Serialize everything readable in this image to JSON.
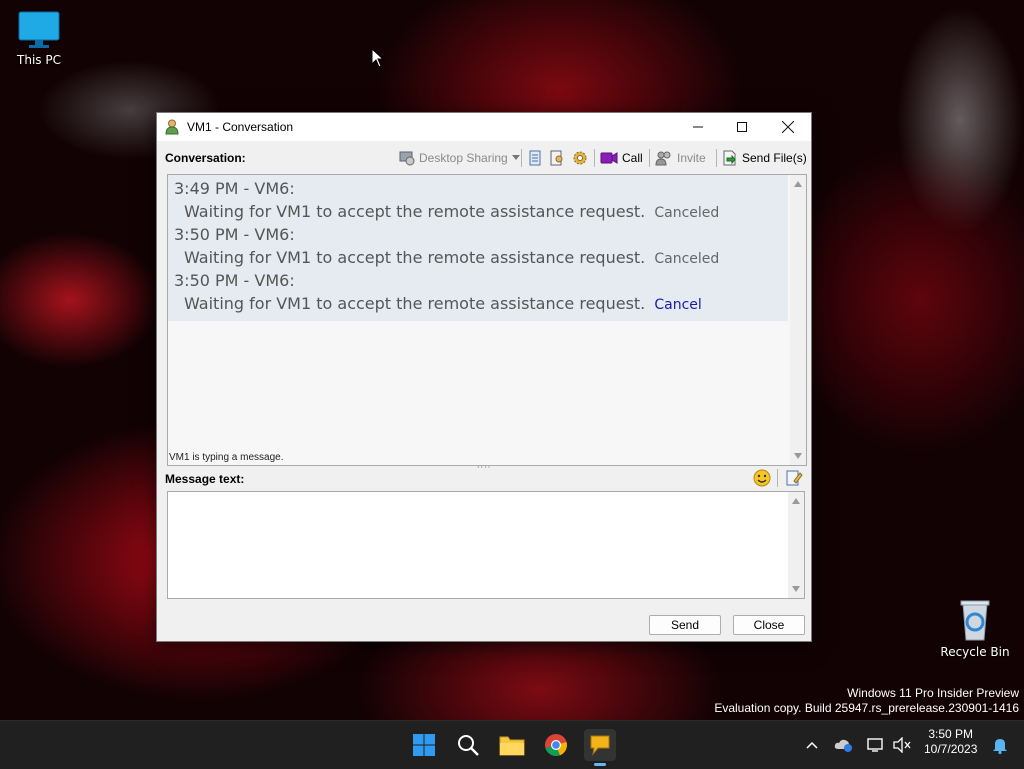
{
  "desktop": {
    "this_pc_label": "This PC",
    "recycle_bin_label": "Recycle Bin",
    "watermark_line1": "Windows 11 Pro Insider Preview",
    "watermark_line2": "Evaluation copy. Build 25947.rs_prerelease.230901-1416"
  },
  "window": {
    "title": "VM1 - Conversation",
    "toolbar": {
      "conversation_label": "Conversation:",
      "desktop_sharing": "Desktop Sharing",
      "call": "Call",
      "invite": "Invite",
      "send_files": "Send File(s)"
    },
    "messages": [
      {
        "header": "3:49 PM - VM6:",
        "text": "Waiting for VM1 to accept the remote assistance request.",
        "status": "Canceled"
      },
      {
        "header": "3:50 PM - VM6:",
        "text": "Waiting for VM1 to accept the remote assistance request.",
        "status": "Canceled"
      },
      {
        "header": "3:50 PM - VM6:",
        "text": "Waiting for VM1 to accept the remote assistance request.",
        "status": "Cancel"
      }
    ],
    "typing_status": "VM1 is typing a message.",
    "message_label": "Message text:",
    "message_value": "",
    "send_button": "Send",
    "close_button": "Close"
  },
  "taskbar": {
    "clock_time": "3:50 PM",
    "clock_date": "10/7/2023"
  },
  "colors": {
    "link": "#1a1aa6",
    "taskbar": "#202020",
    "message_highlight": "#e6ebf2"
  }
}
